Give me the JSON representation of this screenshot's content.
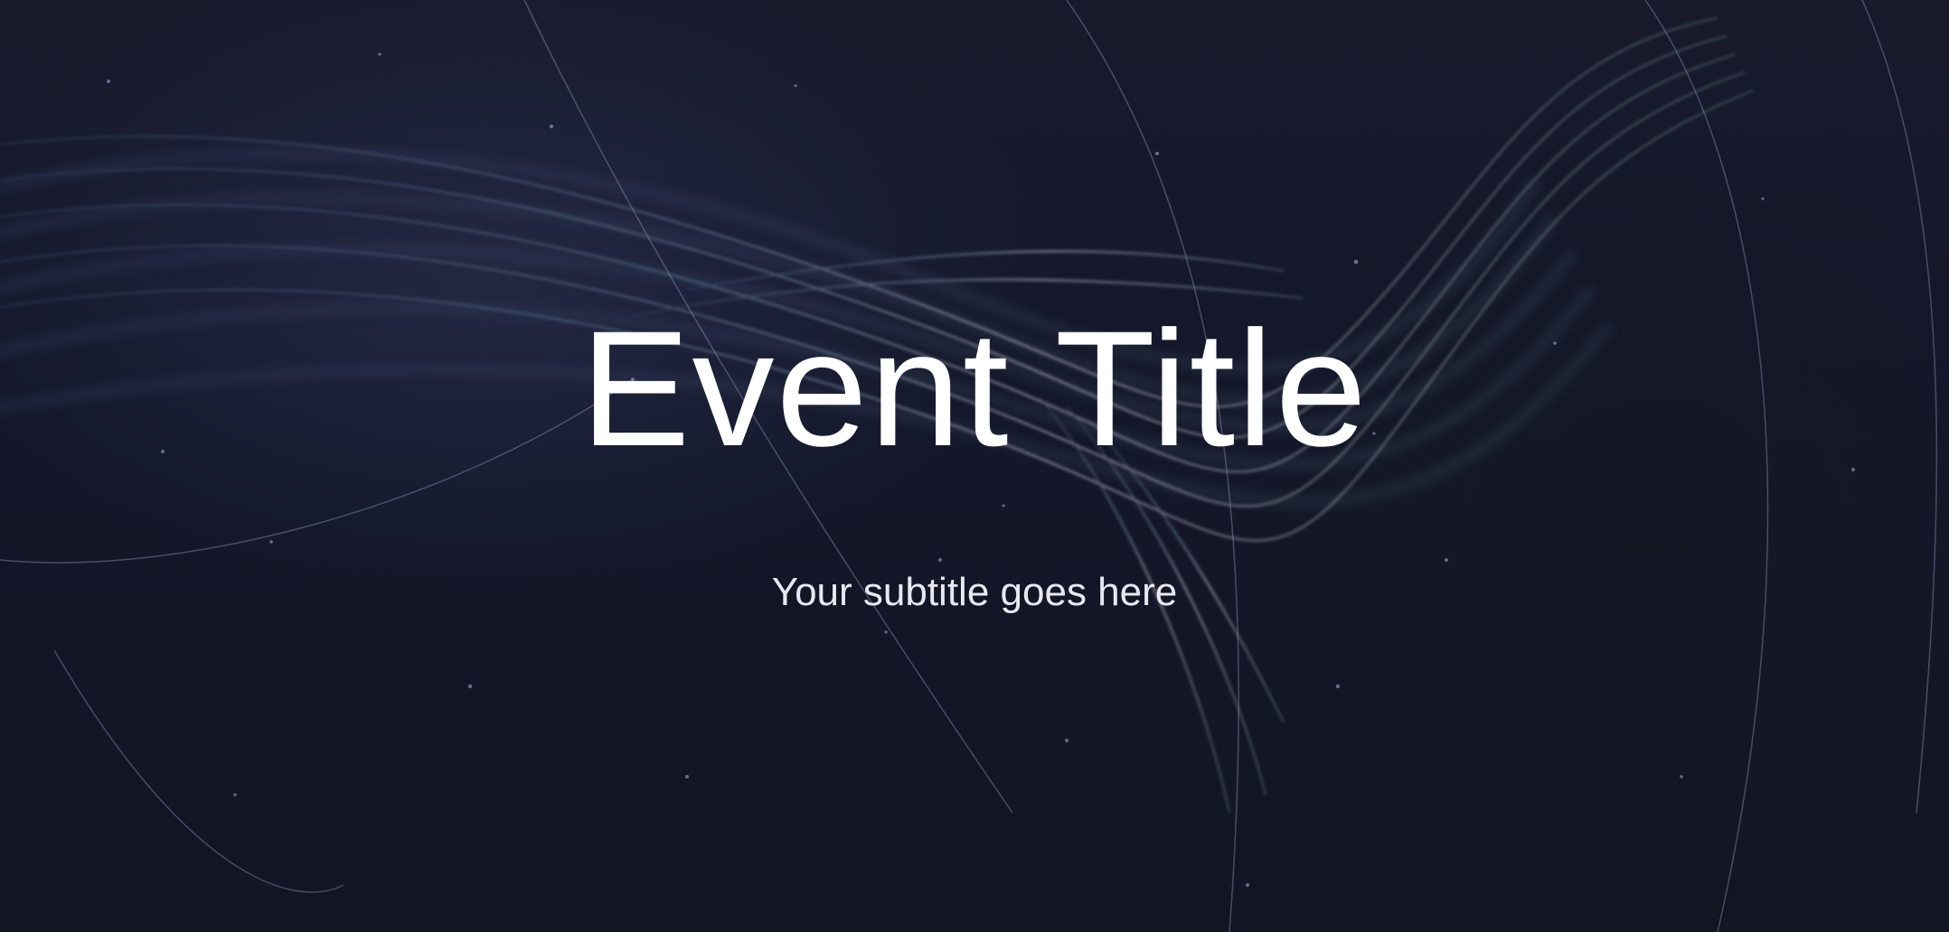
{
  "slide": {
    "title": "Event Title",
    "subtitle": "Your subtitle goes here"
  },
  "colors": {
    "background": "#151724",
    "text": "#ffffff",
    "subtitle_text": "#e8e9f0",
    "accent_strands": "#7f93a8"
  }
}
